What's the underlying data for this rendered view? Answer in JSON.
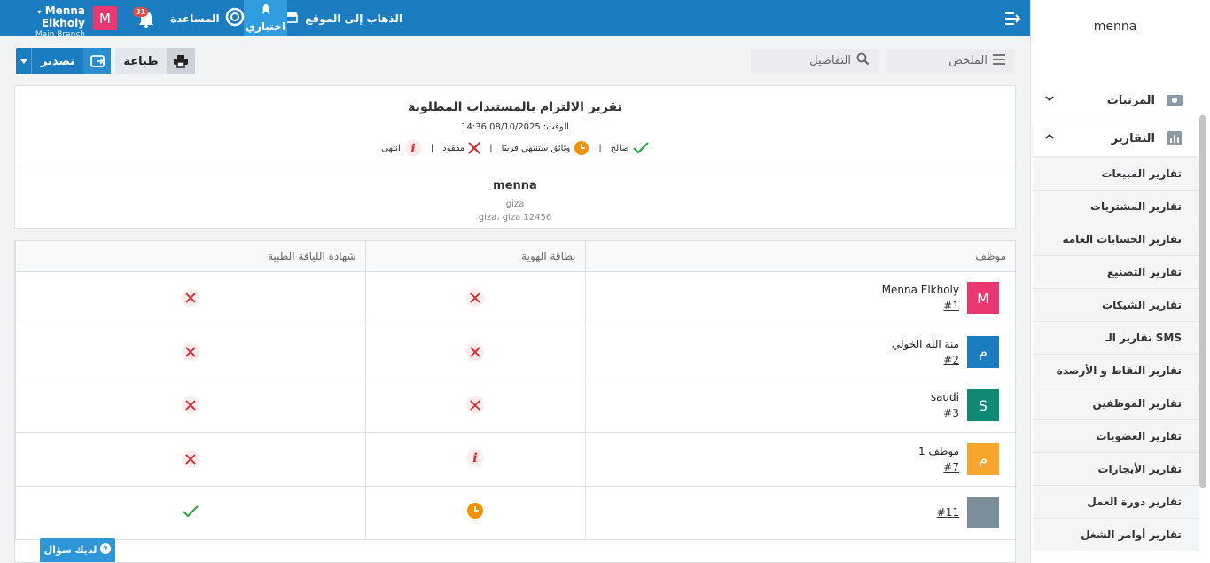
{
  "topbar": {
    "visit_site": "الذهاب إلى الموقع",
    "test_label": "اختباري",
    "help": "المساعدة",
    "notifications_count": "31",
    "avatar_letter": "M",
    "user_name": "Menna Elkholy",
    "branch": "Main Branch"
  },
  "toolbar": {
    "print": "طباعة",
    "export": "تصدير"
  },
  "tabs": {
    "summary": "الملخص",
    "details": "التفاصيل"
  },
  "report": {
    "title": "تقرير الالتزام بالمستندات المطلوبة",
    "time": "الوقت: 08/10/2025 14:36",
    "legend": {
      "valid": "صالح",
      "expiring": "وثائق ستنتهي قريبًا",
      "missing": "مفقود",
      "expired": "انتهى"
    },
    "company": "menna",
    "address_line1": "giza",
    "address_line2": "giza، giza 12456"
  },
  "table": {
    "headers": {
      "employee": "موظف",
      "id_card": "بطاقة الهوية",
      "fitness_cert": "شهادة اللياقة الطبية"
    },
    "rows": [
      {
        "avatar": "M",
        "avatar_color": "#e8386f",
        "name": "Menna Elkholy",
        "code": "#1",
        "id_card": "missing",
        "fitness": "missing"
      },
      {
        "avatar": "م",
        "avatar_color": "#1b7dc0",
        "name": "منة الله الخولي",
        "code": "#2",
        "id_card": "missing",
        "fitness": "missing"
      },
      {
        "avatar": "S",
        "avatar_color": "#0e8a72",
        "name": "saudi",
        "code": "#3",
        "id_card": "missing",
        "fitness": "missing"
      },
      {
        "avatar": "م",
        "avatar_color": "#f7a52d",
        "name": "موظف 1",
        "code": "#7",
        "id_card": "expired",
        "fitness": "missing"
      },
      {
        "avatar": "",
        "avatar_color": "#7b8f99",
        "name": "",
        "code": "#11",
        "id_card": "expiring",
        "fitness": "valid"
      }
    ]
  },
  "sidebar": {
    "user": "menna",
    "groups": {
      "payroll": "المرتبات",
      "reports": "التقارير"
    },
    "report_items": [
      "تقارير المبيعات",
      "تقارير المشتريات",
      "تقارير الحسابات العامة",
      "تقارير التصنيع",
      "تقارير الشيكات",
      "تقارير الـ SMS",
      "تقارير النقاط و الأرصدة",
      "تقارير الموظفين",
      "تقارير العضويات",
      "تقارير الأيجارات",
      "تقارير دورة العمل",
      "تقارير أوامر الشغل"
    ]
  },
  "help_widget": "لديك سؤال"
}
